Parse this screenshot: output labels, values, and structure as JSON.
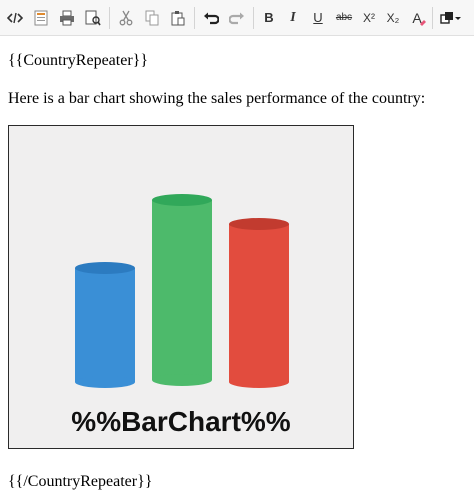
{
  "toolbar": {
    "buttons": [
      {
        "name": "source-code",
        "icon": "code-icon"
      },
      {
        "name": "template",
        "icon": "template-icon"
      },
      {
        "name": "print",
        "icon": "print-icon"
      },
      {
        "name": "preview",
        "icon": "preview-icon"
      },
      {
        "name": "cut",
        "icon": "scissors-icon"
      },
      {
        "name": "copy",
        "icon": "copy-icon"
      },
      {
        "name": "paste",
        "icon": "paste-icon"
      },
      {
        "name": "undo",
        "icon": "undo-icon"
      },
      {
        "name": "redo",
        "icon": "redo-icon"
      },
      {
        "name": "bold",
        "label": "B"
      },
      {
        "name": "italic",
        "label": "I"
      },
      {
        "name": "underline",
        "label": "U"
      },
      {
        "name": "strikethrough",
        "label": "abc"
      },
      {
        "name": "superscript",
        "label": "X²"
      },
      {
        "name": "subscript",
        "label": "X₂"
      },
      {
        "name": "clear-format",
        "label": "A"
      },
      {
        "name": "more",
        "icon": "more-icon"
      }
    ]
  },
  "editor": {
    "repeater_start": "{{CountryRepeater}}",
    "intro_text": "Here is a bar chart showing the sales performance of the country:",
    "placeholder_image": {
      "label": "%%BarChart%%",
      "colors": {
        "blue": "#3a8fd6",
        "green": "#4dba6b",
        "red": "#e24c3e",
        "background": "#f0efef"
      }
    },
    "repeater_end": "{{/CountryRepeater}}"
  }
}
